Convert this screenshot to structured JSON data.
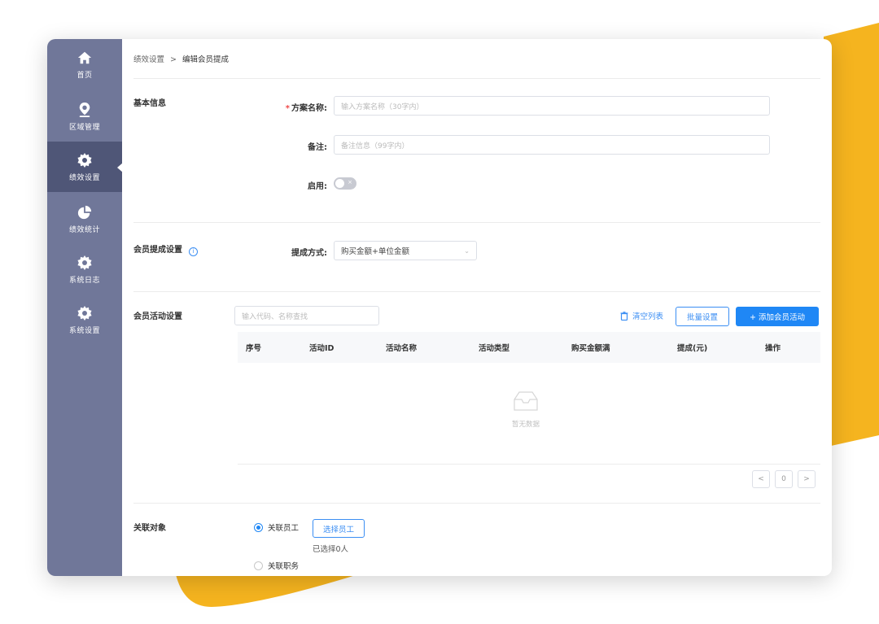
{
  "sidebar": {
    "items": [
      {
        "label": "首页",
        "icon": "home-icon"
      },
      {
        "label": "区域管理",
        "icon": "location-pin-icon"
      },
      {
        "label": "绩效设置",
        "icon": "gear-icon",
        "active": true
      },
      {
        "label": "绩效统计",
        "icon": "pie-chart-icon"
      },
      {
        "label": "系统日志",
        "icon": "gear-icon"
      },
      {
        "label": "系统设置",
        "icon": "gear-icon"
      }
    ]
  },
  "breadcrumb": {
    "parent": "绩效设置",
    "separator": ">",
    "current": "编辑会员提成"
  },
  "basic_info": {
    "title": "基本信息",
    "plan_name": {
      "label": "方案名称:",
      "required": "*",
      "placeholder": "输入方案名称（30字内）"
    },
    "remark": {
      "label": "备注:",
      "placeholder": "备注信息（99字内）"
    },
    "enable": {
      "label": "启用:",
      "toggle_mark": "×",
      "on": false
    }
  },
  "commission": {
    "title": "会员提成设置",
    "info_glyph": "i",
    "method_label": "提成方式:",
    "method_value": "购买金额+单位金额"
  },
  "activity": {
    "title": "会员活动设置",
    "search_placeholder": "输入代码、名称查找",
    "clear_label": "清空列表",
    "batch_label": "批量设置",
    "add_label": "+ 添加会员活动",
    "columns": [
      "序号",
      "活动ID",
      "活动名称",
      "活动类型",
      "购买金额满",
      "提成(元)",
      "操作"
    ],
    "empty_text": "暂无数据",
    "pagination": {
      "prev": "<",
      "page": "0",
      "next": ">"
    }
  },
  "relation": {
    "title": "关联对象",
    "option_staff": "关联员工",
    "select_staff_label": "选择员工",
    "selected_text": "已选择0人",
    "option_position": "关联职务"
  },
  "colors": {
    "sidebar_bg": "#707799",
    "sidebar_active": "#4f5677",
    "accent": "#1f87f5",
    "decor_yellow": "#f5b41f"
  }
}
